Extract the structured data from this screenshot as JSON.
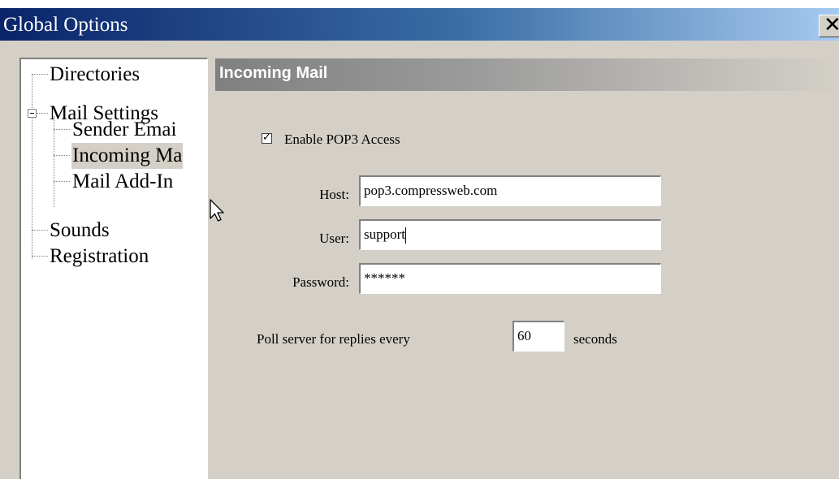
{
  "window": {
    "title": "Global Options",
    "close_glyph": "✕"
  },
  "tree": {
    "items": [
      {
        "label": "Directories"
      },
      {
        "label": "Mail Settings",
        "expanded": true
      },
      {
        "label": "Sender Emai"
      },
      {
        "label": "Incoming Ma",
        "selected": true
      },
      {
        "label": "Mail Add-In"
      },
      {
        "label": "Sounds"
      },
      {
        "label": "Registration"
      }
    ]
  },
  "panel": {
    "header": "Incoming Mail",
    "enable_pop3": {
      "label": "Enable POP3 Access",
      "checked": true,
      "check_glyph": "✓"
    },
    "host": {
      "label": "Host:",
      "value": "pop3.compressweb.com"
    },
    "user": {
      "label": "User:",
      "value": "support"
    },
    "password": {
      "label": "Password:",
      "value": "******"
    },
    "poll": {
      "label": "Poll server for replies every",
      "value": "60",
      "unit": "seconds"
    }
  },
  "icons": {
    "close": "close-icon",
    "expander": "minus-box-icon",
    "cursor": "mouse-pointer-icon"
  }
}
